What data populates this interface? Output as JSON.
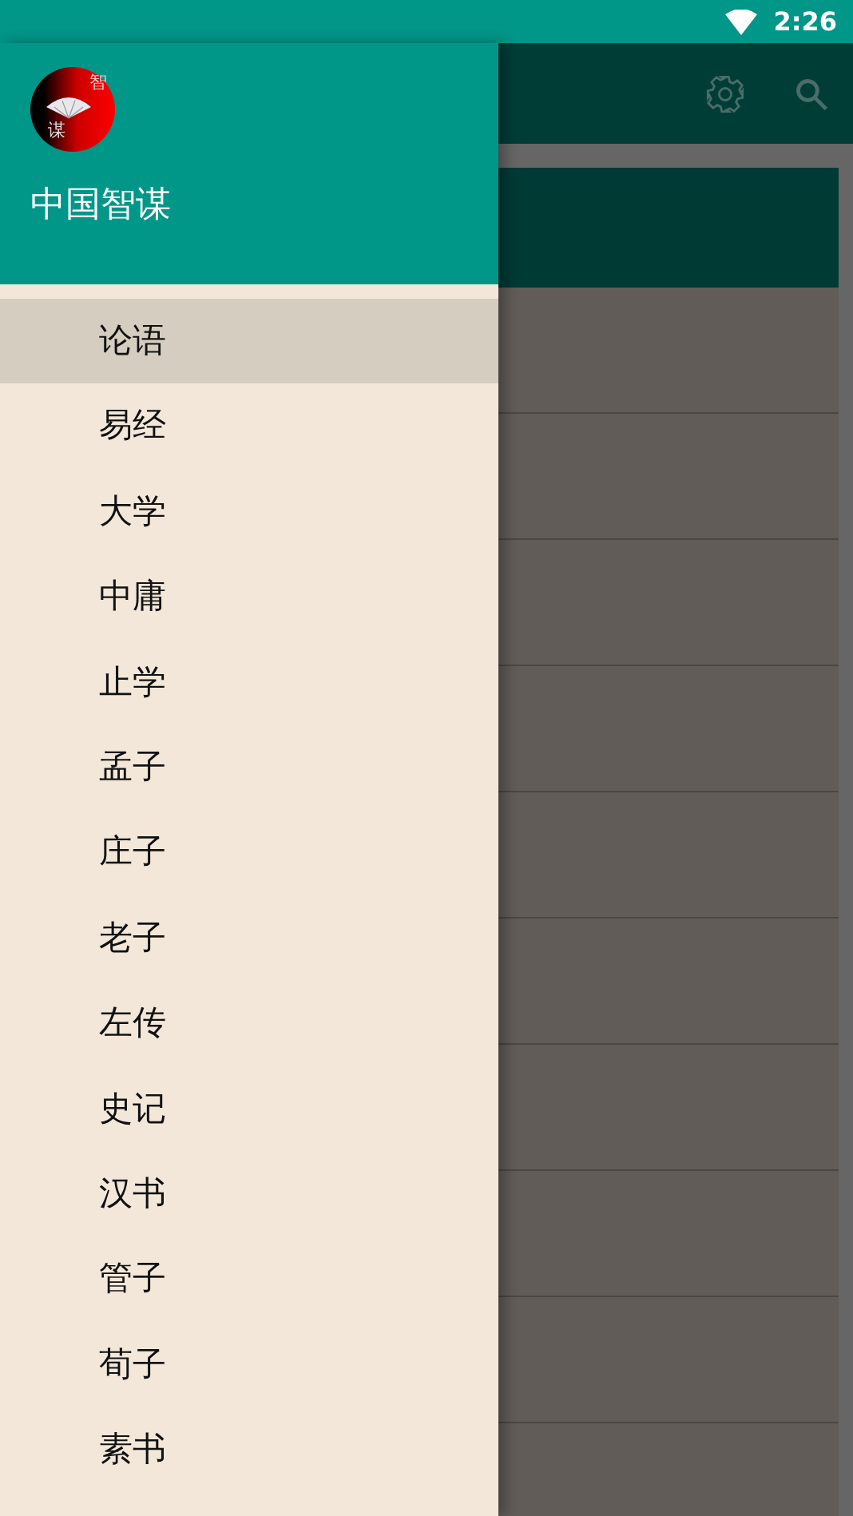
{
  "status_bar": {
    "time": "2:26"
  },
  "drawer": {
    "logo": {
      "chars": [
        "智",
        "谋"
      ]
    },
    "title": "中国智谋",
    "items": [
      {
        "label": "论语",
        "selected": true
      },
      {
        "label": "易经",
        "selected": false
      },
      {
        "label": "大学",
        "selected": false
      },
      {
        "label": "中庸",
        "selected": false
      },
      {
        "label": "止学",
        "selected": false
      },
      {
        "label": "孟子",
        "selected": false
      },
      {
        "label": "庄子",
        "selected": false
      },
      {
        "label": "老子",
        "selected": false
      },
      {
        "label": "左传",
        "selected": false
      },
      {
        "label": "史记",
        "selected": false
      },
      {
        "label": "汉书",
        "selected": false
      },
      {
        "label": "管子",
        "selected": false
      },
      {
        "label": "荀子",
        "selected": false
      },
      {
        "label": "素书",
        "selected": false
      }
    ]
  }
}
